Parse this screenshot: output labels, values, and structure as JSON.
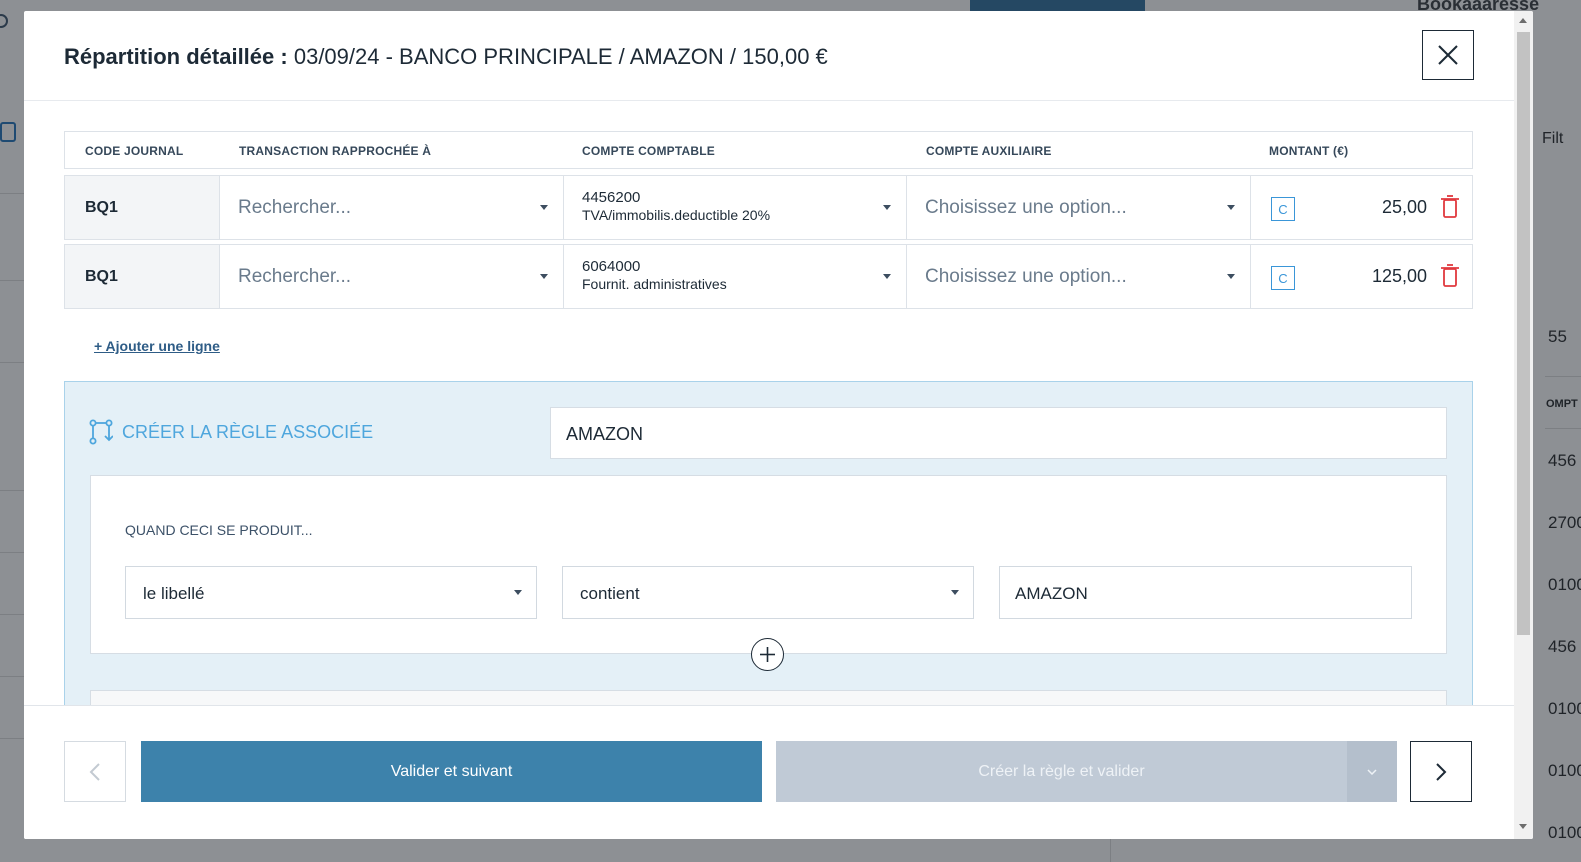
{
  "background": {
    "title": "Bookaaaresse",
    "filter_label": "Filt",
    "side_numbers": [
      "55",
      "456",
      "2700",
      "0100",
      "456",
      "0100",
      "0100",
      "0100"
    ],
    "side_column": "OMPT"
  },
  "modal": {
    "title_bold": "Répartition détaillée :",
    "title_detail": "03/09/24 - BANCO PRINCIPALE / AMAZON / 150,00 €",
    "close_icon": "close-icon"
  },
  "table": {
    "headers": [
      "CODE JOURNAL",
      "TRANSACTION RAPPROCHÉE À",
      "COMPTE COMPTABLE",
      "COMPTE AUXILIAIRE",
      "MONTANT (€)"
    ],
    "rows": [
      {
        "code": "BQ1",
        "transaction_placeholder": "Rechercher...",
        "account_number": "4456200",
        "account_name": "TVA/immobilis.deductible 20%",
        "aux_placeholder": "Choisissez une option...",
        "badge": "C",
        "amount": "25,00"
      },
      {
        "code": "BQ1",
        "transaction_placeholder": "Rechercher...",
        "account_number": "6064000",
        "account_name": "Fournit. administratives",
        "aux_placeholder": "Choisissez une option...",
        "badge": "C",
        "amount": "125,00"
      }
    ],
    "add_line": "+ Ajouter une ligne"
  },
  "rule": {
    "title": "CRÉER LA RÈGLE ASSOCIÉE",
    "name_value": "AMAZON",
    "condition_label": "QUAND CECI SE PRODUIT...",
    "field_select": "le libellé",
    "operator_select": "contient",
    "value_input": "AMAZON"
  },
  "footer": {
    "primary_label": "Valider et suivant",
    "secondary_label": "Créer la règle et valider"
  },
  "colors": {
    "primary": "#3d82ab",
    "rule_accent": "#4ea6dd",
    "delete": "#e0393e"
  }
}
